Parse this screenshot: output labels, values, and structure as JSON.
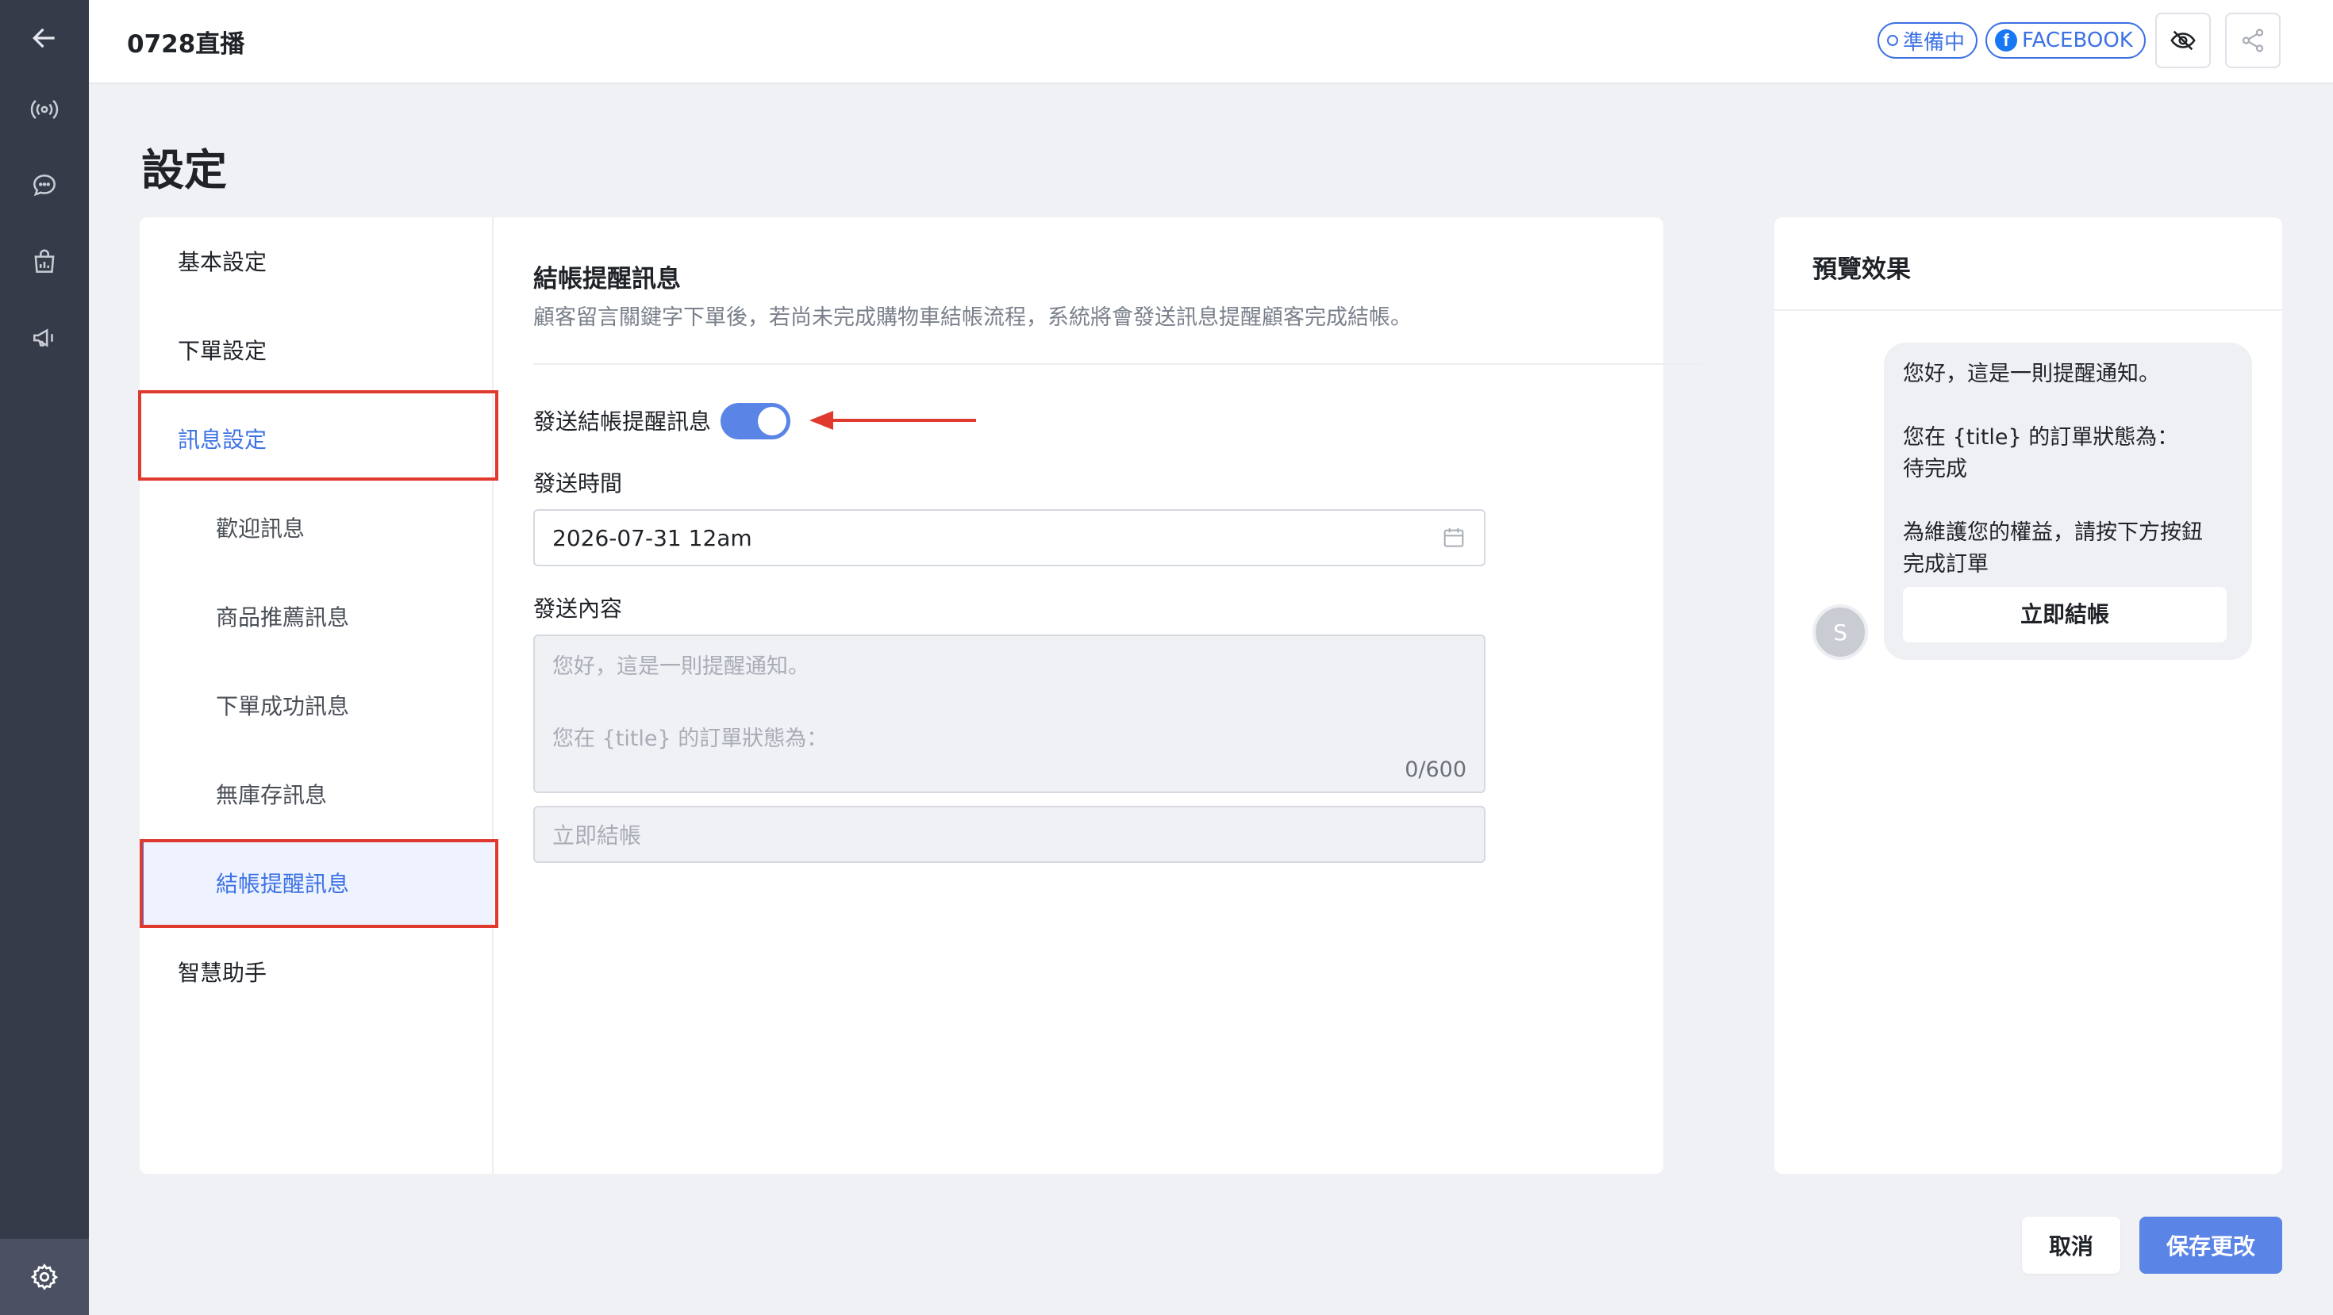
{
  "topbar": {
    "title": "0728直播",
    "status_pill": "準備中",
    "platform_pill": "FACEBOOK",
    "platform_icon": "facebook-icon"
  },
  "page_title": "設定",
  "nav": {
    "items": [
      {
        "label": "基本設定"
      },
      {
        "label": "下單設定"
      },
      {
        "label": "訊息設定"
      },
      {
        "label": "歡迎訊息"
      },
      {
        "label": "商品推薦訊息"
      },
      {
        "label": "下單成功訊息"
      },
      {
        "label": "無庫存訊息"
      },
      {
        "label": "結帳提醒訊息"
      },
      {
        "label": "智慧助手"
      }
    ]
  },
  "section": {
    "title": "結帳提醒訊息",
    "description": "顧客留言關鍵字下單後，若尚未完成購物車結帳流程，系統將會發送訊息提醒顧客完成結帳。",
    "toggle_label": "發送結帳提醒訊息",
    "toggle_on": true,
    "send_time_label": "發送時間",
    "send_time_value": "2026-07-31 12am",
    "content_label": "發送內容",
    "content_placeholder_line1": "您好，這是一則提醒通知。",
    "content_placeholder_line2": "您在 {title} 的訂單狀態為：",
    "content_counter": "0/600",
    "button_placeholder": "立即結帳"
  },
  "preview": {
    "title": "預覽效果",
    "avatar_letter": "S",
    "line1": "您好，這是一則提醒通知。",
    "line2": "您在 {title} 的訂單狀態為：",
    "line3": "待完成",
    "line4": "為維護您的權益，請按下方按鈕",
    "line5": "完成訂單",
    "button": "立即結帳"
  },
  "footer": {
    "cancel": "取消",
    "save": "保存更改"
  },
  "colors": {
    "accent": "#3d72e4",
    "toggle": "#5a85e6",
    "sidebar": "#363b4a",
    "highlight_box": "#e03a2f"
  }
}
